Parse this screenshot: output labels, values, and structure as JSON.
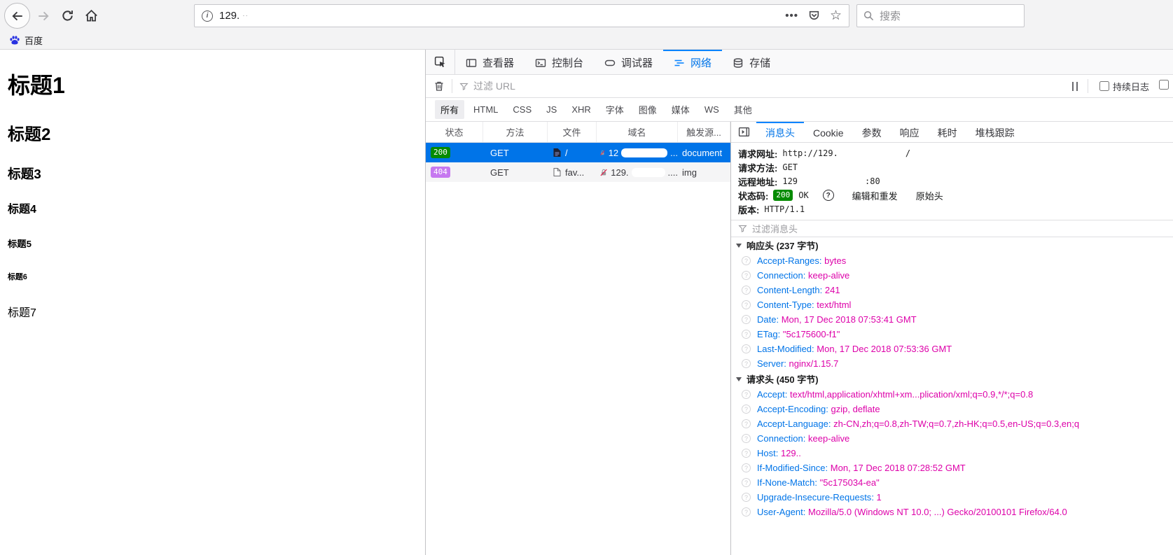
{
  "browser": {
    "nav_icons": [
      "back-arrow",
      "forward-arrow",
      "reload",
      "home"
    ],
    "url_bar": {
      "info_icon": "info-circle",
      "url_text": "129.",
      "censored_hint": "··",
      "more_icon": "ellipsis",
      "pocket_icon": "pocket-shield",
      "star_icon": "bookmark-star"
    },
    "search": {
      "icon": "magnifier",
      "placeholder": "搜索"
    },
    "bookmarks": [
      {
        "label": "百度",
        "icon": "baidu-paw"
      }
    ]
  },
  "page": {
    "headings": [
      "标题1",
      "标题2",
      "标题3",
      "标题4",
      "标题5",
      "标题6",
      "标题7"
    ]
  },
  "devtools": {
    "tabs": [
      {
        "label": "查看器",
        "active": false
      },
      {
        "label": "控制台",
        "active": false
      },
      {
        "label": "调试器",
        "active": false
      },
      {
        "label": "网络",
        "active": true
      },
      {
        "label": "存储",
        "active": false
      }
    ],
    "network_toolbar": {
      "trash_icon": "trash",
      "filter_placeholder": "过滤 URL",
      "pause_icon": "pause",
      "persist_log_label": "持续日志"
    },
    "type_filters": [
      {
        "label": "所有",
        "active": true
      },
      {
        "label": "HTML",
        "active": false
      },
      {
        "label": "CSS",
        "active": false
      },
      {
        "label": "JS",
        "active": false
      },
      {
        "label": "XHR",
        "active": false
      },
      {
        "label": "字体",
        "active": false
      },
      {
        "label": "图像",
        "active": false
      },
      {
        "label": "媒体",
        "active": false
      },
      {
        "label": "WS",
        "active": false
      },
      {
        "label": "其他",
        "active": false
      }
    ],
    "request_table": {
      "columns": [
        "状态",
        "方法",
        "文件",
        "域名",
        "触发源..."
      ],
      "rows": [
        {
          "status": "200",
          "method": "GET",
          "file": "/",
          "domain_prefix": "12",
          "domain_suffix": "...",
          "cause": "document",
          "selected": true
        },
        {
          "status": "404",
          "method": "GET",
          "file": "fav...",
          "domain_prefix": "129.",
          "domain_suffix": "....",
          "cause": "img",
          "selected": false
        }
      ]
    },
    "details": {
      "tabs": [
        {
          "label": "消息头",
          "active": true
        },
        {
          "label": "Cookie",
          "active": false
        },
        {
          "label": "参数",
          "active": false
        },
        {
          "label": "响应",
          "active": false
        },
        {
          "label": "耗时",
          "active": false
        },
        {
          "label": "堆栈跟踪",
          "active": false
        }
      ],
      "summary": {
        "url_label": "请求网址:",
        "url_value_prefix": "http://129.",
        "url_value_suffix": "/",
        "method_label": "请求方法:",
        "method_value": "GET",
        "remote_label": "远程地址:",
        "remote_value_prefix": "129",
        "remote_value_suffix": ":80",
        "status_label": "状态码:",
        "status_code": "200",
        "status_text": "OK",
        "edit_resend_label": "编辑和重发",
        "raw_headers_label": "原始头",
        "version_label": "版本:",
        "version_value": "HTTP/1.1"
      },
      "filter_placeholder": "过滤消息头",
      "sections": [
        {
          "title": "响应头 (237 字节)",
          "headers": [
            {
              "name": "Accept-Ranges",
              "value": "bytes"
            },
            {
              "name": "Connection",
              "value": "keep-alive"
            },
            {
              "name": "Content-Length",
              "value": "241"
            },
            {
              "name": "Content-Type",
              "value": "text/html"
            },
            {
              "name": "Date",
              "value": "Mon, 17 Dec 2018 07:53:41 GMT"
            },
            {
              "name": "ETag",
              "value": "\"5c175600-f1\""
            },
            {
              "name": "Last-Modified",
              "value": "Mon, 17 Dec 2018 07:53:36 GMT"
            },
            {
              "name": "Server",
              "value": "nginx/1.15.7"
            }
          ]
        },
        {
          "title": "请求头 (450 字节)",
          "headers": [
            {
              "name": "Accept",
              "value": "text/html,application/xhtml+xm...plication/xml;q=0.9,*/*;q=0.8"
            },
            {
              "name": "Accept-Encoding",
              "value": "gzip, deflate"
            },
            {
              "name": "Accept-Language",
              "value": "zh-CN,zh;q=0.8,zh-TW;q=0.7,zh-HK;q=0.5,en-US;q=0.3,en;q"
            },
            {
              "name": "Connection",
              "value": "keep-alive"
            },
            {
              "name": "Host",
              "value": "129.."
            },
            {
              "name": "If-Modified-Since",
              "value": "Mon, 17 Dec 2018 07:28:52 GMT"
            },
            {
              "name": "If-None-Match",
              "value": "\"5c175034-ea\""
            },
            {
              "name": "Upgrade-Insecure-Requests",
              "value": "1"
            },
            {
              "name": "User-Agent",
              "value": "Mozilla/5.0 (Windows NT 10.0; ...) Gecko/20100101 Firefox/64.0"
            }
          ]
        }
      ]
    },
    "colors": {
      "accent_blue": "#0074e8",
      "selected_row": "#0074e8",
      "status_200_badge": "#058b00",
      "status_404_badge": "#c678f0",
      "header_name": "#0074e8",
      "header_value": "#dd00a9"
    }
  }
}
